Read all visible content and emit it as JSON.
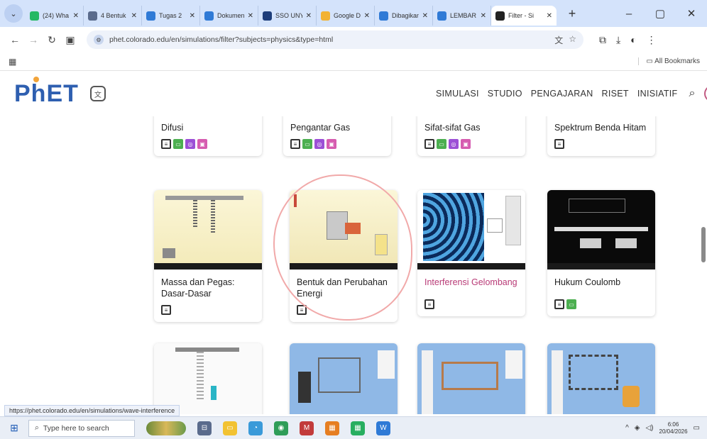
{
  "browser": {
    "tabs": [
      {
        "title": "(24) Wha",
        "color": "#25b864"
      },
      {
        "title": "4 Bentuk",
        "color": "#5a6b8c"
      },
      {
        "title": "Tugas 2",
        "color": "#2f7ad6"
      },
      {
        "title": "Dokumen",
        "color": "#2f7ad6"
      },
      {
        "title": "SSO UNY",
        "color": "#1d3d7a"
      },
      {
        "title": "Google D",
        "color": "#f2b233"
      },
      {
        "title": "Dibagikan",
        "color": "#2f7ad6"
      },
      {
        "title": "LEMBAR",
        "color": "#2f7ad6"
      },
      {
        "title": "Filter - Si",
        "color": "#222222"
      }
    ],
    "url": "phet.colorado.edu/en/simulations/filter?subjects=physics&type=html",
    "all_bookmarks": "All Bookmarks",
    "status_url": "https://phet.colorado.edu/en/simulations/wave-interference"
  },
  "header": {
    "logo": "PhET",
    "nav": [
      "SIMULASI",
      "STUDIO",
      "PENGAJARAN",
      "RISET",
      "INISIATIF"
    ]
  },
  "cards_row1": [
    {
      "title": "Difusi",
      "badges": [
        "html",
        "sim",
        "find",
        "prez"
      ]
    },
    {
      "title": "Pengantar Gas",
      "badges": [
        "html",
        "sim",
        "find",
        "prez"
      ]
    },
    {
      "title": "Sifat-sifat Gas",
      "badges": [
        "html",
        "sim",
        "find",
        "prez"
      ]
    },
    {
      "title": "Spektrum Benda Hitam",
      "badges": [
        "html"
      ]
    }
  ],
  "cards_row2": [
    {
      "title": "Massa dan Pegas: Dasar-Dasar",
      "badges": [
        "html"
      ]
    },
    {
      "title": "Bentuk dan Perubahan Energi",
      "badges": [
        "html"
      ]
    },
    {
      "title": "Interferensi Gelombang",
      "badges": [
        "html"
      ]
    },
    {
      "title": "Hukum Coulomb",
      "badges": [
        "html",
        "sim"
      ]
    }
  ],
  "taskbar": {
    "search_placeholder": "Type here to search",
    "time": "6:06",
    "date": "20/04/2026"
  }
}
